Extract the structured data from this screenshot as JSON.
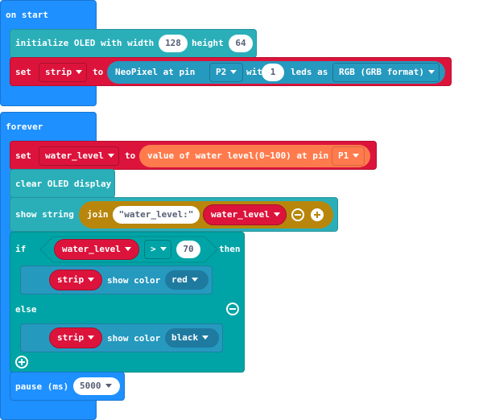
{
  "on_start": {
    "label": "on start",
    "init_oled": {
      "label": "initialize OLED with width",
      "width_value": "128",
      "height_label": "height",
      "height_value": "64"
    },
    "set_strip": {
      "set_label": "set",
      "variable": "strip",
      "to_label": "to",
      "neopixel_label": "NeoPixel at pin",
      "pin": "P2",
      "with_label": "with",
      "leds_count": "1",
      "leds_as_label": "leds as",
      "format": "RGB (GRB format)"
    }
  },
  "forever": {
    "label": "forever",
    "set_water": {
      "set_label": "set",
      "variable": "water_level",
      "to_label": "to",
      "sensor_label": "value of water level(0~100) at pin",
      "pin": "P1"
    },
    "clear_oled": {
      "label": "clear OLED display"
    },
    "show_string": {
      "label": "show string",
      "join_label": "join",
      "string_value": "\"water_level:\"",
      "variable": "water_level"
    },
    "if_block": {
      "if_label": "if",
      "variable": "water_level",
      "operator": ">",
      "compare_value": "70",
      "then_label": "then",
      "then_action": {
        "variable": "strip",
        "label": "show color",
        "color": "red"
      },
      "else_label": "else",
      "else_action": {
        "variable": "strip",
        "label": "show color",
        "color": "black"
      }
    },
    "pause": {
      "label": "pause (ms)",
      "value": "5000"
    }
  },
  "colors": {
    "event": "#1e90ff",
    "oled": "#2aafb9",
    "variables": "#dc143c",
    "neopixel": "#2699bf",
    "logic": "#00a4a6",
    "text": "#b8860b",
    "sensor": "#ff7b4d"
  }
}
